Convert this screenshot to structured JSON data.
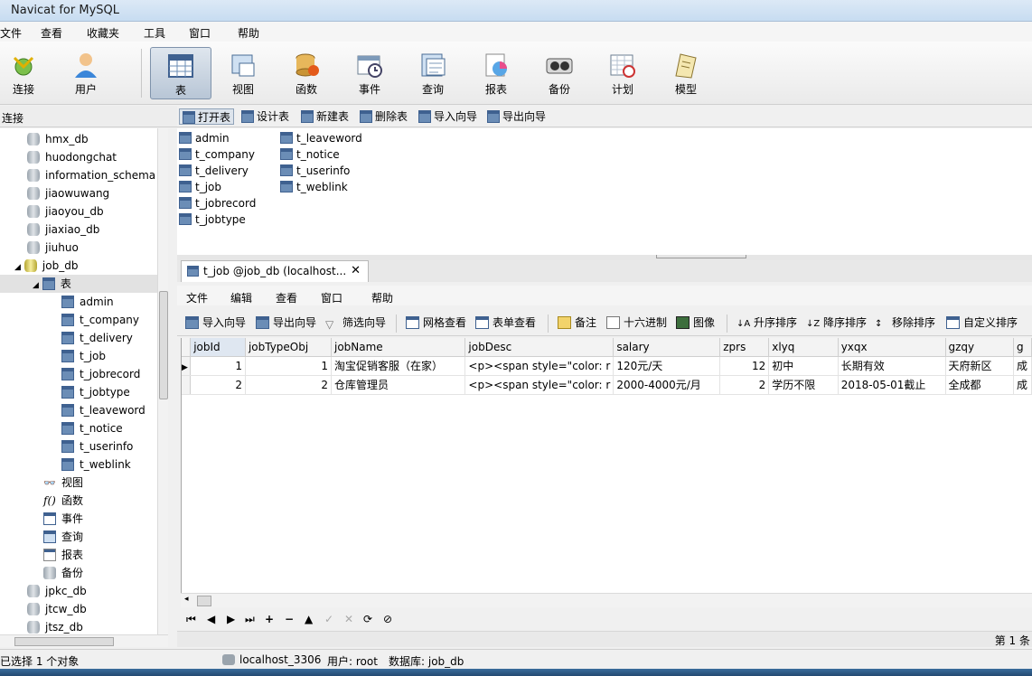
{
  "window": {
    "title": "Navicat for MySQL"
  },
  "menu": [
    "文件",
    "查看",
    "收藏夹",
    "工具",
    "窗口",
    "帮助"
  ],
  "toolbar": [
    {
      "label": "连接",
      "icon": "connect-icon"
    },
    {
      "label": "用户",
      "icon": "user-icon"
    },
    {
      "label": "表",
      "icon": "table-icon",
      "active": true
    },
    {
      "label": "视图",
      "icon": "view-icon"
    },
    {
      "label": "函数",
      "icon": "function-icon"
    },
    {
      "label": "事件",
      "icon": "event-icon"
    },
    {
      "label": "查询",
      "icon": "query-icon"
    },
    {
      "label": "报表",
      "icon": "report-icon"
    },
    {
      "label": "备份",
      "icon": "backup-icon"
    },
    {
      "label": "计划",
      "icon": "schedule-icon"
    },
    {
      "label": "模型",
      "icon": "model-icon"
    }
  ],
  "sidebar": {
    "header": "连接",
    "items": [
      "hmx_db",
      "huodongchat",
      "information_schema",
      "jiaowuwang",
      "jiaoyou_db",
      "jiaxiao_db",
      "jiuhuo",
      "job_db",
      "表",
      "admin",
      "t_company",
      "t_delivery",
      "t_job",
      "t_jobrecord",
      "t_jobtype",
      "t_leaveword",
      "t_notice",
      "t_userinfo",
      "t_weblink",
      "视图",
      "函数",
      "事件",
      "查询",
      "报表",
      "备份",
      "jpkc_db",
      "jtcw_db",
      "jtsz_db"
    ]
  },
  "object_toolbar": [
    "打开表",
    "设计表",
    "新建表",
    "删除表",
    "导入向导",
    "导出向导"
  ],
  "objects": [
    "admin",
    "t_company",
    "t_delivery",
    "t_job",
    "t_jobrecord",
    "t_jobtype",
    "t_leaveword",
    "t_notice",
    "t_userinfo",
    "t_weblink"
  ],
  "doc_tab": {
    "title": "t_job @job_db (localhost...",
    "close": "✕"
  },
  "inner_menu": [
    "文件",
    "编辑",
    "查看",
    "窗口",
    "帮助"
  ],
  "inner_toolbar": [
    "导入向导",
    "导出向导",
    "筛选向导",
    "网格查看",
    "表单查看",
    "备注",
    "十六进制",
    "图像",
    "升序排序",
    "降序排序",
    "移除排序",
    "自定义排序"
  ],
  "grid": {
    "columns": [
      "jobId",
      "jobTypeObj",
      "jobName",
      "jobDesc",
      "salary",
      "zprs",
      "xlyq",
      "yxqx",
      "gzqy",
      "g"
    ],
    "rows": [
      [
        "1",
        "1",
        "淘宝促销客服（在家）",
        "<p><span style=\"color: r",
        "120元/天",
        "12",
        "初中",
        "长期有效",
        "天府新区",
        "成"
      ],
      [
        "2",
        "2",
        "仓库管理员",
        "<p><span style=\"color: r",
        "2000-4000元/月",
        "2",
        "学历不限",
        "2018-05-01截止",
        "全成都",
        "成"
      ]
    ]
  },
  "nav": [
    "⏮",
    "◀",
    "▶",
    "⏭",
    "+",
    "−",
    "▲",
    "✓",
    "✕",
    "⟳",
    "⊘"
  ],
  "record_status": "第 1 条",
  "status": {
    "selection": "已选择 1 个对象",
    "host": "localhost_3306",
    "user": "用户: root",
    "database": "数据库: job_db"
  }
}
